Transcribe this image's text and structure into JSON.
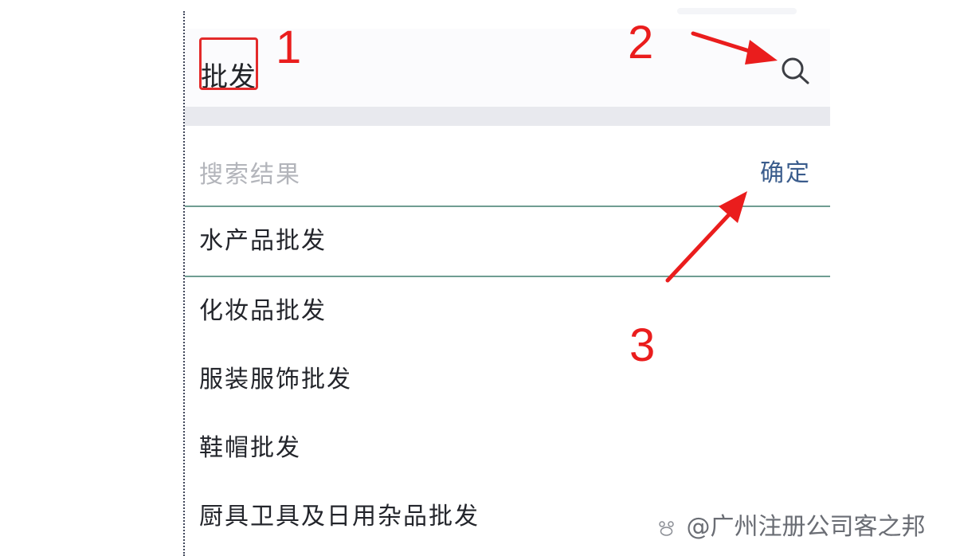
{
  "search": {
    "value": "批发",
    "icon": "search-icon"
  },
  "results": {
    "title": "搜索结果",
    "confirm_label": "确定",
    "items": [
      {
        "label": "水产品批发",
        "selected": true
      },
      {
        "label": "化妆品批发",
        "selected": false
      },
      {
        "label": "服装服饰批发",
        "selected": false
      },
      {
        "label": "鞋帽批发",
        "selected": false
      },
      {
        "label": "厨具卫具及日用杂品批发",
        "selected": false
      }
    ]
  },
  "annotations": {
    "labels": [
      "1",
      "2",
      "3"
    ],
    "color": "#e32a2a"
  },
  "watermark": {
    "text": "@广州注册公司客之邦"
  },
  "colors": {
    "confirm": "#3a5c8c",
    "selected_border": "#6f9d92",
    "placeholder": "#b3b5bb"
  }
}
